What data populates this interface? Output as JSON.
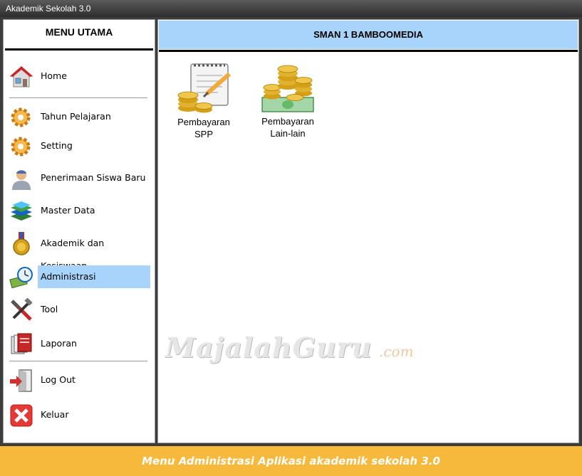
{
  "window": {
    "title": "Akademik Sekolah 3.0"
  },
  "sidebar": {
    "heading": "MENU UTAMA",
    "items": [
      {
        "label": "Home",
        "icon": "house-icon"
      },
      {
        "label": "Tahun Pelajaran",
        "icon": "gear-icon"
      },
      {
        "label": "Setting",
        "icon": "gear-icon"
      },
      {
        "label": "Penerimaan Siswa Baru",
        "icon": "student-icon"
      },
      {
        "label": "Master Data",
        "icon": "books-icon"
      },
      {
        "label": "Akademik dan Kesiswaan",
        "icon": "medal-icon"
      },
      {
        "label": "Administrasi",
        "icon": "money-clock-icon",
        "active": true
      },
      {
        "label": "Tool",
        "icon": "tools-icon"
      },
      {
        "label": "Laporan",
        "icon": "report-icon"
      },
      {
        "label": "Log Out",
        "icon": "logout-door-icon"
      },
      {
        "label": "Keluar",
        "icon": "close-icon"
      }
    ]
  },
  "main": {
    "school_name": "SMAN 1 BAMBOOMEDIA",
    "tiles": [
      {
        "line1": "Pembayaran",
        "line2": "SPP",
        "icon": "coins-notepad-icon"
      },
      {
        "line1": "Pembayaran",
        "line2": "Lain-lain",
        "icon": "coins-cash-icon"
      }
    ]
  },
  "watermark": {
    "text": "MajalahGuru",
    "suffix": ".com"
  },
  "caption": "Menu Administrasi Aplikasi akademik sekolah 3.0",
  "colors": {
    "highlight": "#a8d3fb",
    "caption_bg": "#f6b93b",
    "titlebar": "#3c3c3c"
  }
}
